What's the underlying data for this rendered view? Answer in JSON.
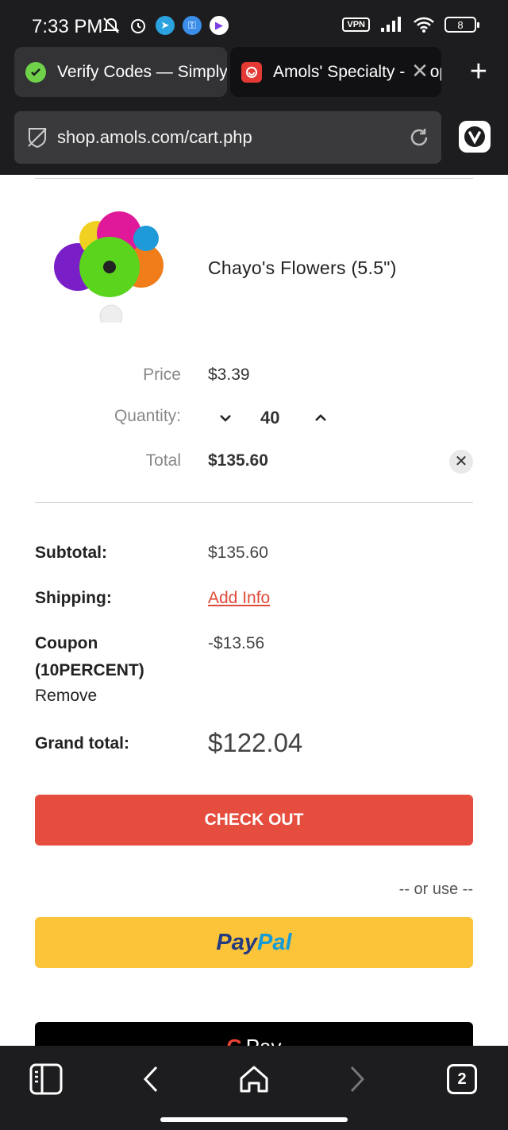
{
  "status_bar": {
    "time": "7:33 PM",
    "vpn": "VPN",
    "battery": "8",
    "icons": [
      "mute-icon",
      "alarm-icon",
      "telegram-icon",
      "key-icon",
      "play-icon",
      "signal-icon",
      "wifi-icon",
      "battery-icon"
    ]
  },
  "tabs": [
    {
      "title": "Verify Codes — SimplyCodes",
      "favicon": "simplycodes-icon",
      "favicon_color": "#6fd14a"
    },
    {
      "title": "Amols' Specialty - Shop",
      "favicon": "amols-icon",
      "favicon_color": "#e53935"
    }
  ],
  "address_bar": {
    "url": "shop.amols.com/cart.php"
  },
  "cart_item": {
    "name": "Chayo's Flowers (5.5\")",
    "price_label": "Price",
    "price": "$3.39",
    "quantity_label": "Quantity:",
    "quantity": "40",
    "total_label": "Total",
    "total": "$135.60"
  },
  "summary": {
    "subtotal_label": "Subtotal:",
    "subtotal": "$135.60",
    "shipping_label": "Shipping:",
    "shipping_value": "Add Info",
    "coupon_label": "Coupon",
    "coupon_code": "(10PERCENT)",
    "coupon_remove": "Remove",
    "coupon_value": "-$13.56",
    "grand_total_label": "Grand total:",
    "grand_total": "$122.04"
  },
  "actions": {
    "checkout": "CHECK OUT",
    "or_use": "-- or use --",
    "paypal_a": "Pay",
    "paypal_b": "Pal",
    "gpay_g": "G",
    "gpay_text": "Pay"
  },
  "bottom_nav": {
    "tab_count": "2"
  },
  "colors": {
    "accent_red": "#e54d3e",
    "paypal_yellow": "#fcc439",
    "chrome_dark": "#1d1d1f"
  }
}
